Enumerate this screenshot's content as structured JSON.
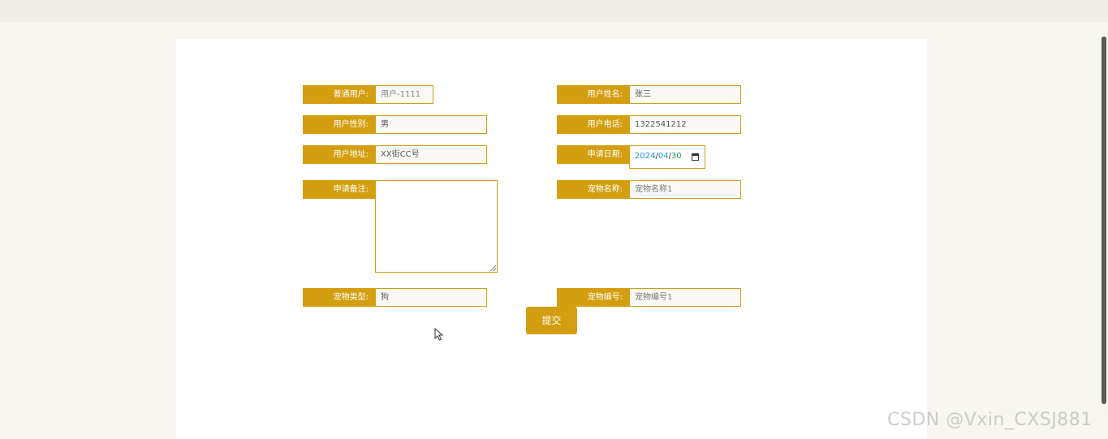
{
  "form": {
    "fields": {
      "user_account": {
        "label": "普通用户:",
        "value": "用户-1111"
      },
      "user_name": {
        "label": "用户姓名:",
        "value": "张三"
      },
      "user_gender": {
        "label": "用户性别:",
        "value": "男"
      },
      "user_phone": {
        "label": "用户电话:",
        "value": "1322541212"
      },
      "user_address": {
        "label": "用户地址:",
        "value": "XX街CC号"
      },
      "apply_date": {
        "label": "申请日期:",
        "year": "2024",
        "month": "04",
        "day": "30",
        "sep": "/"
      },
      "apply_remark": {
        "label": "申请备注:",
        "value": ""
      },
      "pet_name": {
        "label": "宠物名称:",
        "placeholder": "宠物名称1"
      },
      "pet_type": {
        "label": "宠物类型:",
        "value": "狗"
      },
      "pet_number": {
        "label": "宠物编号:",
        "placeholder": "宠物编号1"
      }
    },
    "submit_label": "提交"
  },
  "watermark": "CSDN @Vxin_CXSJ881",
  "colors": {
    "accent": "#d39f11",
    "page_background": "#f7f6ef",
    "panel_background": "#ffffff"
  }
}
